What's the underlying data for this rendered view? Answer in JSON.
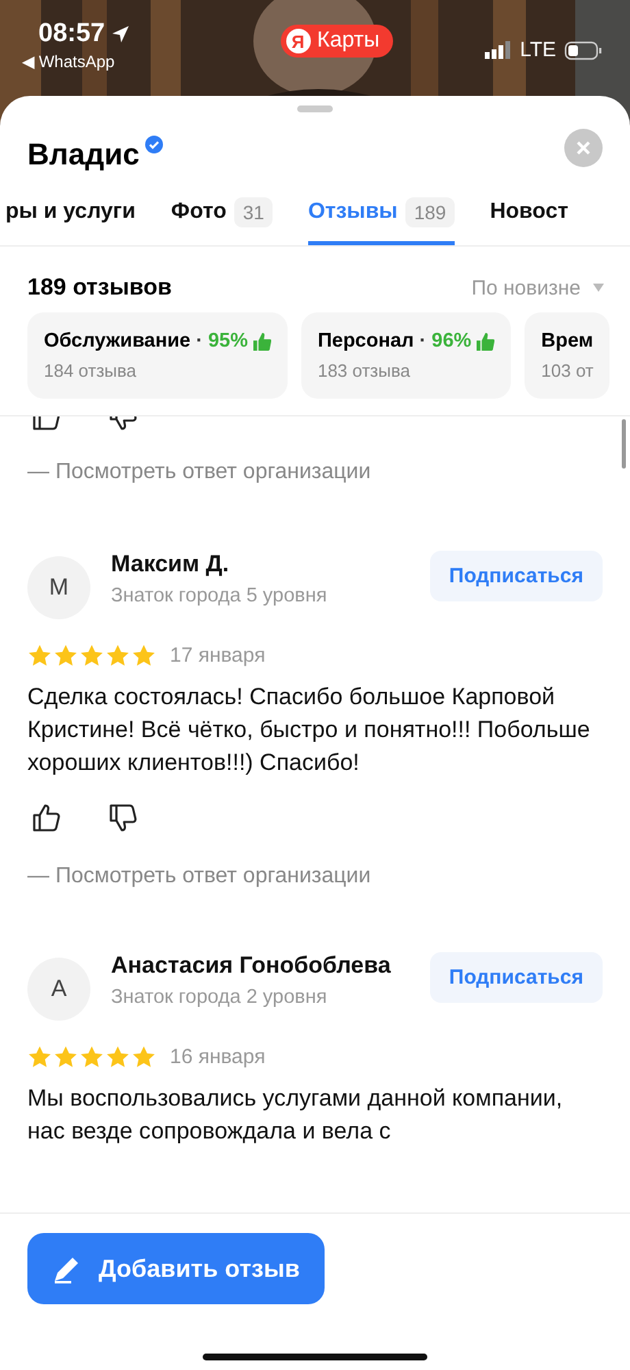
{
  "status_bar": {
    "time": "08:57",
    "back_app": "◀ WhatsApp",
    "app_badge": "Карты",
    "app_badge_logo": "Я",
    "network": "LTE"
  },
  "place": {
    "name": "Владис",
    "verified": true
  },
  "tabs": [
    {
      "label": "ры и услуги",
      "selected": false
    },
    {
      "label": "Фото",
      "count": "31",
      "selected": false
    },
    {
      "label": "Отзывы",
      "count": "189",
      "selected": true
    },
    {
      "label": "Новост",
      "selected": false
    }
  ],
  "reviews_header": {
    "count": "189 отзывов",
    "sort": "По новизне"
  },
  "aspects": [
    {
      "name": "Обслуживание",
      "separator": "·",
      "percent": "95%",
      "count": "184 отзыва"
    },
    {
      "name": "Персонал",
      "separator": "·",
      "percent": "96%",
      "count": "183 отзыва"
    },
    {
      "name": "Врем",
      "count": "103 от"
    }
  ],
  "reviews": [
    {
      "kind": "partial",
      "reply_link": "— Посмотреть ответ организации"
    },
    {
      "kind": "full",
      "avatar": "М",
      "name": "Максим Д.",
      "level": "Знаток города 5 уровня",
      "subscribe": "Подписаться",
      "stars": 5,
      "date": "17 января",
      "text": "Сделка состоялась! Спасибо большое Карповой Кристине! Всё чётко, быстро и понятно!!! Побольше хороших клиентов!!!) Спасибо!",
      "reply_link": "— Посмотреть ответ организации"
    },
    {
      "kind": "full",
      "avatar": "А",
      "name": "Анастасия Гонобоблева",
      "level": "Знаток города 2 уровня",
      "subscribe": "Подписаться",
      "stars": 5,
      "date": "16 января",
      "text": "Мы воспользовались услугами данной компании, нас везде сопровождала и вела с"
    }
  ],
  "add_button": "Добавить отзыв"
}
